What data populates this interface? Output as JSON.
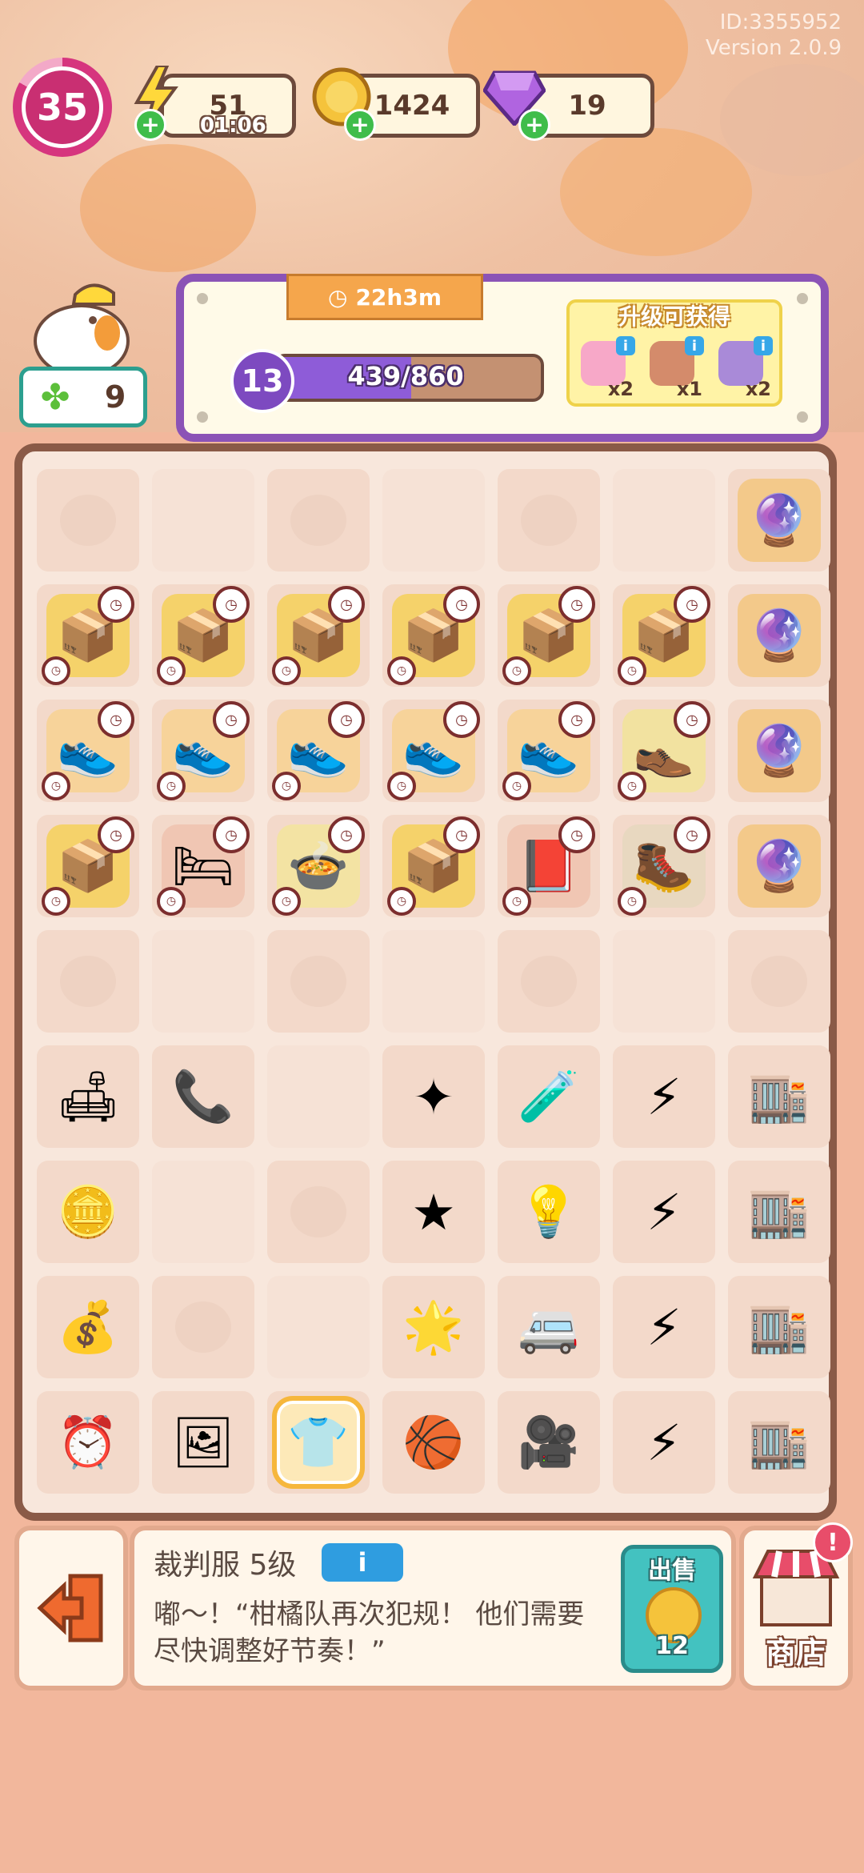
{
  "header": {
    "id_text": "ID:3355952",
    "version_text": "Version 2.0.9",
    "level": "35",
    "energy": {
      "value": "51",
      "timer": "01:06",
      "icon": "lightning-icon"
    },
    "coins": {
      "value": "1424",
      "icon": "coin-icon"
    },
    "gems": {
      "value": "19",
      "icon": "gem-icon"
    }
  },
  "player": {
    "avatar": "chick-avatar",
    "clover_count": "9"
  },
  "task": {
    "timer": "22h3m",
    "level": "13",
    "progress_text": "439/860",
    "progress_fraction": 0.51,
    "rewards_title": "升级可获得",
    "rewards": [
      {
        "name": "brain-item",
        "count": "x2",
        "color": "#f7a8c8"
      },
      {
        "name": "card-item",
        "count": "x1",
        "color": "#d48b6b"
      },
      {
        "name": "character-item",
        "count": "x2",
        "color": "#a98ad8"
      }
    ]
  },
  "board": {
    "columns": 7,
    "rows": 9,
    "cells": [
      [
        {
          "t": "empty"
        },
        {
          "t": "blank"
        },
        {
          "t": "empty"
        },
        {
          "t": "blank"
        },
        {
          "t": "empty"
        },
        {
          "t": "blank"
        },
        {
          "t": "item",
          "name": "glass-dome-generator",
          "g": "🔮",
          "c": "#f3c98a"
        }
      ],
      [
        {
          "t": "item",
          "name": "shoebox",
          "g": "📦",
          "c": "#f5d26a",
          "clock": true
        },
        {
          "t": "item",
          "name": "shoebox",
          "g": "📦",
          "c": "#f5d26a",
          "clock": true
        },
        {
          "t": "item",
          "name": "shoebox",
          "g": "📦",
          "c": "#f5d26a",
          "clock": true
        },
        {
          "t": "item",
          "name": "shoebox",
          "g": "📦",
          "c": "#f5d26a",
          "clock": true
        },
        {
          "t": "item",
          "name": "shoebox",
          "g": "📦",
          "c": "#f5d26a",
          "clock": true
        },
        {
          "t": "item",
          "name": "shoebox",
          "g": "📦",
          "c": "#f5d26a",
          "clock": true
        },
        {
          "t": "item",
          "name": "glass-dome-generator",
          "g": "🔮",
          "c": "#f3c98a"
        }
      ],
      [
        {
          "t": "item",
          "name": "sneakers",
          "g": "👟",
          "c": "#f7d39a",
          "clock": true
        },
        {
          "t": "item",
          "name": "sneakers",
          "g": "👟",
          "c": "#f7d39a",
          "clock": true
        },
        {
          "t": "item",
          "name": "sneakers",
          "g": "👟",
          "c": "#f7d39a",
          "clock": true
        },
        {
          "t": "item",
          "name": "sneakers",
          "g": "👟",
          "c": "#f7d39a",
          "clock": true
        },
        {
          "t": "item",
          "name": "sneakers",
          "g": "👟",
          "c": "#f7d39a",
          "clock": true
        },
        {
          "t": "item",
          "name": "worn-sneaker",
          "g": "👞",
          "c": "#f2e2a0",
          "clock": true
        },
        {
          "t": "item",
          "name": "glass-dome-generator",
          "g": "🔮",
          "c": "#f3c98a"
        }
      ],
      [
        {
          "t": "item",
          "name": "shoebox",
          "g": "📦",
          "c": "#f5d26a",
          "clock": true
        },
        {
          "t": "item",
          "name": "bed",
          "g": "🛏",
          "c": "#f0c6b3",
          "clock": true
        },
        {
          "t": "item",
          "name": "food-plate",
          "g": "🍲",
          "c": "#f3e3a3",
          "clock": true
        },
        {
          "t": "item",
          "name": "shoebox",
          "g": "📦",
          "c": "#f5d26a",
          "clock": true
        },
        {
          "t": "item",
          "name": "red-book",
          "g": "📕",
          "c": "#f0c6b3",
          "clock": true
        },
        {
          "t": "item",
          "name": "old-sneaker",
          "g": "🥾",
          "c": "#e8d8c0",
          "clock": true
        },
        {
          "t": "item",
          "name": "glass-dome-generator",
          "g": "🔮",
          "c": "#f3c98a"
        }
      ],
      [
        {
          "t": "empty"
        },
        {
          "t": "blank"
        },
        {
          "t": "empty"
        },
        {
          "t": "blank"
        },
        {
          "t": "empty"
        },
        {
          "t": "blank"
        },
        {
          "t": "empty"
        }
      ],
      [
        {
          "t": "item",
          "name": "armchair",
          "g": "🛋",
          "c": "#f3d9ca"
        },
        {
          "t": "item",
          "name": "telephone",
          "g": "📞",
          "c": "#f3d9ca"
        },
        {
          "t": "blank"
        },
        {
          "t": "item",
          "name": "small-star",
          "g": "✦",
          "c": "#f3d9ca"
        },
        {
          "t": "item",
          "name": "potion-bottle",
          "g": "🧪",
          "c": "#f3d9ca"
        },
        {
          "t": "item",
          "name": "energy-crystal",
          "g": "⚡",
          "c": "#f3d9ca"
        },
        {
          "t": "item",
          "name": "building",
          "g": "🏬",
          "c": "#f3d9ca"
        }
      ],
      [
        {
          "t": "item",
          "name": "coin-stack",
          "g": "🪙",
          "c": "#f3d9ca"
        },
        {
          "t": "blank"
        },
        {
          "t": "empty"
        },
        {
          "t": "item",
          "name": "star",
          "g": "★",
          "c": "#f3d9ca"
        },
        {
          "t": "item",
          "name": "light-bulb",
          "g": "💡",
          "c": "#f3d9ca"
        },
        {
          "t": "item",
          "name": "energy-crystal",
          "g": "⚡",
          "c": "#f3d9ca"
        },
        {
          "t": "item",
          "name": "building",
          "g": "🏬",
          "c": "#f3d9ca"
        }
      ],
      [
        {
          "t": "item",
          "name": "coin-pile",
          "g": "💰",
          "c": "#f3d9ca"
        },
        {
          "t": "empty"
        },
        {
          "t": "blank"
        },
        {
          "t": "item",
          "name": "big-star",
          "g": "🌟",
          "c": "#f3d9ca"
        },
        {
          "t": "item",
          "name": "van",
          "g": "🚐",
          "c": "#f3d9ca"
        },
        {
          "t": "item",
          "name": "energy-crystal",
          "g": "⚡",
          "c": "#f3d9ca"
        },
        {
          "t": "item",
          "name": "building",
          "g": "🏬",
          "c": "#f3d9ca"
        }
      ],
      [
        {
          "t": "item",
          "name": "digital-clock",
          "g": "⏰",
          "c": "#f3d9ca"
        },
        {
          "t": "item",
          "name": "easel",
          "g": "🖼",
          "c": "#f3d9ca"
        },
        {
          "t": "item",
          "name": "referee-shirt",
          "g": "👕",
          "c": "#fde9b8",
          "selected": true
        },
        {
          "t": "item",
          "name": "basketball",
          "g": "🏀",
          "c": "#f3d9ca"
        },
        {
          "t": "item",
          "name": "video-camera",
          "g": "🎥",
          "c": "#f3d9ca"
        },
        {
          "t": "item",
          "name": "energy-crystal",
          "g": "⚡",
          "c": "#f3d9ca"
        },
        {
          "t": "item",
          "name": "building",
          "g": "🏬",
          "c": "#f3d9ca"
        }
      ]
    ]
  },
  "detail": {
    "item_name": "裁判服 5级",
    "info_label": "i",
    "description": "嘟～！“柑橘队再次犯规！ 他们需要尽快调整好节奏！”",
    "sell_label": "出售",
    "sell_value": "12",
    "exit_icon": "exit-icon",
    "shop_label": "商店",
    "shop_alert": "!"
  },
  "colors": {
    "background": "#f2b79c",
    "panel_border": "#8b53b6",
    "board_border": "#8a5a47",
    "sell_button": "#43c2c0",
    "level_ring": "#d6357e"
  }
}
